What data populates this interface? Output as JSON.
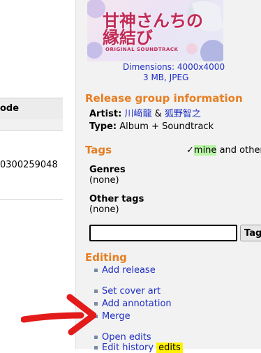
{
  "left_table": {
    "header_label": "ode",
    "cell_value": "0300259048"
  },
  "cover": {
    "title_line1": "甘神さんちの",
    "title_line2": "縁結び",
    "subtitle": "ORIGINAL SOUNDTRACK",
    "dimensions": "Dimensions: 4000x4000",
    "filesize": "3 MB, JPEG"
  },
  "release_group": {
    "heading": "Release group information",
    "artist_label": "Artist:",
    "artist_1": "川﨑龍",
    "artist_sep": "&",
    "artist_2": "狐野智之",
    "type_label": "Type:",
    "type_value": "Album + Soundtrack"
  },
  "tags": {
    "heading": "Tags",
    "check": "✓",
    "mine_label": "mine",
    "others_label": "and others",
    "genres_label": "Genres",
    "genres_value": "(none)",
    "other_tags_label": "Other tags",
    "other_tags_value": "(none)",
    "input_value": "",
    "tag_button_label": "Tag"
  },
  "editing": {
    "heading": "Editing",
    "add_release": "Add release",
    "set_cover_art": "Set cover art",
    "add_annotation": "Add annotation",
    "merge": "Merge",
    "open_edits": "Open edits",
    "edit_history": "Edit history",
    "edit_badge": "edits"
  },
  "colors": {
    "accent_heading": "#e67e22",
    "link": "#1e2ec6",
    "mine_highlight": "#b9f5a7",
    "annotation_arrow": "#e31b1b"
  }
}
